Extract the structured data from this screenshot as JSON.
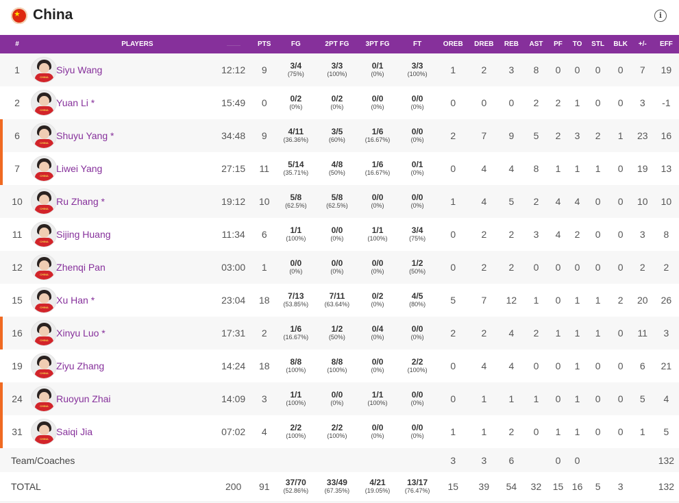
{
  "team": {
    "name": "China",
    "info_icon": "info-icon"
  },
  "headers": [
    "#",
    "PLAYERS",
    "",
    "PTS",
    "FG",
    "2PT FG",
    "3PT FG",
    "FT",
    "OREB",
    "DREB",
    "REB",
    "AST",
    "PF",
    "TO",
    "STL",
    "BLK",
    "+/-",
    "EFF"
  ],
  "colors": {
    "header_bg": "#86309b",
    "starter_bar": "#f06a22",
    "player_link": "#86309b"
  },
  "players": [
    {
      "no": "1",
      "name": "Siyu Wang",
      "starter": false,
      "min": "12:12",
      "pts": "9",
      "fg": [
        "3/4",
        "(75%)"
      ],
      "fg2": [
        "3/3",
        "(100%)"
      ],
      "fg3": [
        "0/1",
        "(0%)"
      ],
      "ft": [
        "3/3",
        "(100%)"
      ],
      "oreb": "1",
      "dreb": "2",
      "reb": "3",
      "ast": "8",
      "pf": "0",
      "to": "0",
      "stl": "0",
      "blk": "0",
      "pm": "7",
      "eff": "19"
    },
    {
      "no": "2",
      "name": "Yuan Li *",
      "starter": false,
      "min": "15:49",
      "pts": "0",
      "fg": [
        "0/2",
        "(0%)"
      ],
      "fg2": [
        "0/2",
        "(0%)"
      ],
      "fg3": [
        "0/0",
        "(0%)"
      ],
      "ft": [
        "0/0",
        "(0%)"
      ],
      "oreb": "0",
      "dreb": "0",
      "reb": "0",
      "ast": "2",
      "pf": "2",
      "to": "1",
      "stl": "0",
      "blk": "0",
      "pm": "3",
      "eff": "-1"
    },
    {
      "no": "6",
      "name": "Shuyu Yang *",
      "starter": true,
      "min": "34:48",
      "pts": "9",
      "fg": [
        "4/11",
        "(36.36%)"
      ],
      "fg2": [
        "3/5",
        "(60%)"
      ],
      "fg3": [
        "1/6",
        "(16.67%)"
      ],
      "ft": [
        "0/0",
        "(0%)"
      ],
      "oreb": "2",
      "dreb": "7",
      "reb": "9",
      "ast": "5",
      "pf": "2",
      "to": "3",
      "stl": "2",
      "blk": "1",
      "pm": "23",
      "eff": "16"
    },
    {
      "no": "7",
      "name": "Liwei Yang",
      "starter": true,
      "min": "27:15",
      "pts": "11",
      "fg": [
        "5/14",
        "(35.71%)"
      ],
      "fg2": [
        "4/8",
        "(50%)"
      ],
      "fg3": [
        "1/6",
        "(16.67%)"
      ],
      "ft": [
        "0/1",
        "(0%)"
      ],
      "oreb": "0",
      "dreb": "4",
      "reb": "4",
      "ast": "8",
      "pf": "1",
      "to": "1",
      "stl": "1",
      "blk": "0",
      "pm": "19",
      "eff": "13"
    },
    {
      "no": "10",
      "name": "Ru Zhang *",
      "starter": false,
      "min": "19:12",
      "pts": "10",
      "fg": [
        "5/8",
        "(62.5%)"
      ],
      "fg2": [
        "5/8",
        "(62.5%)"
      ],
      "fg3": [
        "0/0",
        "(0%)"
      ],
      "ft": [
        "0/0",
        "(0%)"
      ],
      "oreb": "1",
      "dreb": "4",
      "reb": "5",
      "ast": "2",
      "pf": "4",
      "to": "4",
      "stl": "0",
      "blk": "0",
      "pm": "10",
      "eff": "10"
    },
    {
      "no": "11",
      "name": "Sijing Huang",
      "starter": false,
      "min": "11:34",
      "pts": "6",
      "fg": [
        "1/1",
        "(100%)"
      ],
      "fg2": [
        "0/0",
        "(0%)"
      ],
      "fg3": [
        "1/1",
        "(100%)"
      ],
      "ft": [
        "3/4",
        "(75%)"
      ],
      "oreb": "0",
      "dreb": "2",
      "reb": "2",
      "ast": "3",
      "pf": "4",
      "to": "2",
      "stl": "0",
      "blk": "0",
      "pm": "3",
      "eff": "8"
    },
    {
      "no": "12",
      "name": "Zhenqi Pan",
      "starter": false,
      "min": "03:00",
      "pts": "1",
      "fg": [
        "0/0",
        "(0%)"
      ],
      "fg2": [
        "0/0",
        "(0%)"
      ],
      "fg3": [
        "0/0",
        "(0%)"
      ],
      "ft": [
        "1/2",
        "(50%)"
      ],
      "oreb": "0",
      "dreb": "2",
      "reb": "2",
      "ast": "0",
      "pf": "0",
      "to": "0",
      "stl": "0",
      "blk": "0",
      "pm": "2",
      "eff": "2"
    },
    {
      "no": "15",
      "name": "Xu Han *",
      "starter": false,
      "min": "23:04",
      "pts": "18",
      "fg": [
        "7/13",
        "(53.85%)"
      ],
      "fg2": [
        "7/11",
        "(63.64%)"
      ],
      "fg3": [
        "0/2",
        "(0%)"
      ],
      "ft": [
        "4/5",
        "(80%)"
      ],
      "oreb": "5",
      "dreb": "7",
      "reb": "12",
      "ast": "1",
      "pf": "0",
      "to": "1",
      "stl": "1",
      "blk": "2",
      "pm": "20",
      "eff": "26"
    },
    {
      "no": "16",
      "name": "Xinyu Luo *",
      "starter": true,
      "min": "17:31",
      "pts": "2",
      "fg": [
        "1/6",
        "(16.67%)"
      ],
      "fg2": [
        "1/2",
        "(50%)"
      ],
      "fg3": [
        "0/4",
        "(0%)"
      ],
      "ft": [
        "0/0",
        "(0%)"
      ],
      "oreb": "2",
      "dreb": "2",
      "reb": "4",
      "ast": "2",
      "pf": "1",
      "to": "1",
      "stl": "1",
      "blk": "0",
      "pm": "11",
      "eff": "3"
    },
    {
      "no": "19",
      "name": "Ziyu Zhang",
      "starter": false,
      "min": "14:24",
      "pts": "18",
      "fg": [
        "8/8",
        "(100%)"
      ],
      "fg2": [
        "8/8",
        "(100%)"
      ],
      "fg3": [
        "0/0",
        "(0%)"
      ],
      "ft": [
        "2/2",
        "(100%)"
      ],
      "oreb": "0",
      "dreb": "4",
      "reb": "4",
      "ast": "0",
      "pf": "0",
      "to": "1",
      "stl": "0",
      "blk": "0",
      "pm": "6",
      "eff": "21"
    },
    {
      "no": "24",
      "name": "Ruoyun Zhai",
      "starter": true,
      "min": "14:09",
      "pts": "3",
      "fg": [
        "1/1",
        "(100%)"
      ],
      "fg2": [
        "0/0",
        "(0%)"
      ],
      "fg3": [
        "1/1",
        "(100%)"
      ],
      "ft": [
        "0/0",
        "(0%)"
      ],
      "oreb": "0",
      "dreb": "1",
      "reb": "1",
      "ast": "1",
      "pf": "0",
      "to": "1",
      "stl": "0",
      "blk": "0",
      "pm": "5",
      "eff": "4"
    },
    {
      "no": "31",
      "name": "Saiqi Jia",
      "starter": true,
      "min": "07:02",
      "pts": "4",
      "fg": [
        "2/2",
        "(100%)"
      ],
      "fg2": [
        "2/2",
        "(100%)"
      ],
      "fg3": [
        "0/0",
        "(0%)"
      ],
      "ft": [
        "0/0",
        "(0%)"
      ],
      "oreb": "1",
      "dreb": "1",
      "reb": "2",
      "ast": "0",
      "pf": "1",
      "to": "1",
      "stl": "0",
      "blk": "0",
      "pm": "1",
      "eff": "5"
    }
  ],
  "team_coaches": {
    "label": "Team/Coaches",
    "oreb": "3",
    "dreb": "3",
    "reb": "6",
    "pf": "0",
    "to": "0",
    "eff": "132"
  },
  "total": {
    "label": "TOTAL",
    "min": "200",
    "pts": "91",
    "fg": [
      "37/70",
      "(52.86%)"
    ],
    "fg2": [
      "33/49",
      "(67.35%)"
    ],
    "fg3": [
      "4/21",
      "(19.05%)"
    ],
    "ft": [
      "13/17",
      "(76.47%)"
    ],
    "oreb": "15",
    "dreb": "39",
    "reb": "54",
    "ast": "32",
    "pf": "15",
    "to": "16",
    "stl": "5",
    "blk": "3",
    "eff": "132"
  }
}
